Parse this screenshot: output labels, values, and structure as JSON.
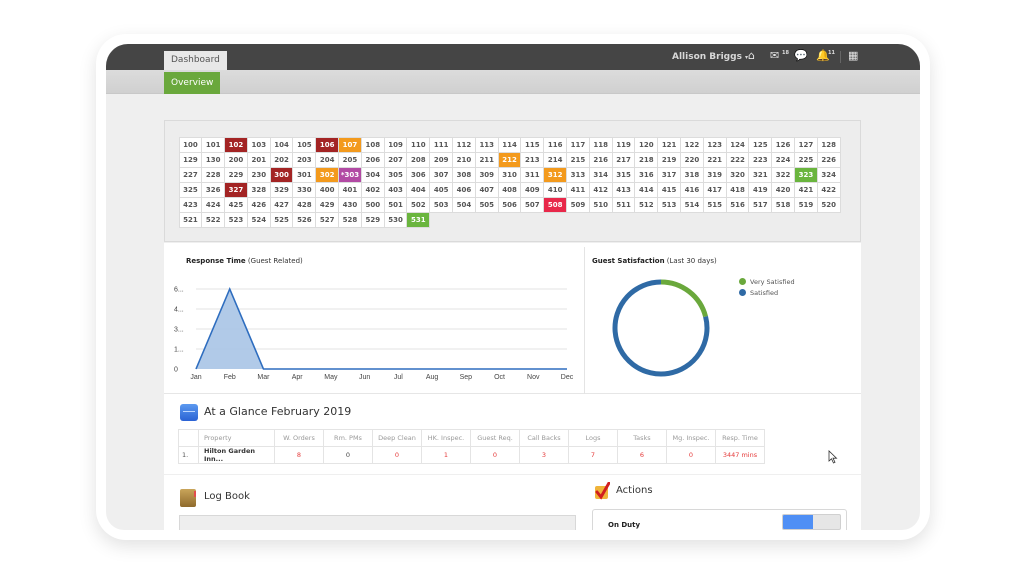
{
  "topbar": {
    "tab_label": "Dashboard",
    "user_name": "Allison Briggs",
    "user_caret": "▾",
    "icons": [
      {
        "name": "home-icon",
        "glyph": "⌂",
        "badge": ""
      },
      {
        "name": "mail-icon",
        "glyph": "✉",
        "badge": "18"
      },
      {
        "name": "chat-icon",
        "glyph": "💬",
        "badge": ""
      },
      {
        "name": "bell-icon",
        "glyph": "🔔",
        "badge": "11"
      },
      {
        "name": "grid-menu-icon",
        "glyph": "▦",
        "badge": ""
      }
    ]
  },
  "subbar": {
    "tab_label": "Overview",
    "accent": "#6aa83c"
  },
  "room_status_colors": {
    "dark": "#a32424",
    "orange": "#f39a1d",
    "purple": "#b24aa4",
    "red": "#e8284a",
    "green": "#6ab53e"
  },
  "rooms": [
    {
      "n": "100"
    },
    {
      "n": "101"
    },
    {
      "n": "102",
      "s": "dark"
    },
    {
      "n": "103"
    },
    {
      "n": "104"
    },
    {
      "n": "105"
    },
    {
      "n": "106",
      "s": "dark"
    },
    {
      "n": "107",
      "s": "orange"
    },
    {
      "n": "108"
    },
    {
      "n": "109"
    },
    {
      "n": "110"
    },
    {
      "n": "111"
    },
    {
      "n": "112"
    },
    {
      "n": "113"
    },
    {
      "n": "114"
    },
    {
      "n": "115"
    },
    {
      "n": "116"
    },
    {
      "n": "117"
    },
    {
      "n": "118"
    },
    {
      "n": "119"
    },
    {
      "n": "120"
    },
    {
      "n": "121"
    },
    {
      "n": "122"
    },
    {
      "n": "123"
    },
    {
      "n": "124"
    },
    {
      "n": "125"
    },
    {
      "n": "126"
    },
    {
      "n": "127"
    },
    {
      "n": "128"
    },
    {
      "n": "129"
    },
    {
      "n": "130"
    },
    {
      "n": "200"
    },
    {
      "n": "201"
    },
    {
      "n": "202"
    },
    {
      "n": "203"
    },
    {
      "n": "204"
    },
    {
      "n": "205"
    },
    {
      "n": "206"
    },
    {
      "n": "207"
    },
    {
      "n": "208"
    },
    {
      "n": "209"
    },
    {
      "n": "210"
    },
    {
      "n": "211"
    },
    {
      "n": "212",
      "s": "orange"
    },
    {
      "n": "213"
    },
    {
      "n": "214"
    },
    {
      "n": "215"
    },
    {
      "n": "216"
    },
    {
      "n": "217"
    },
    {
      "n": "218"
    },
    {
      "n": "219"
    },
    {
      "n": "220"
    },
    {
      "n": "221"
    },
    {
      "n": "222"
    },
    {
      "n": "223"
    },
    {
      "n": "224"
    },
    {
      "n": "225"
    },
    {
      "n": "226"
    },
    {
      "n": "227"
    },
    {
      "n": "228"
    },
    {
      "n": "229"
    },
    {
      "n": "230"
    },
    {
      "n": "300",
      "s": "dark"
    },
    {
      "n": "301"
    },
    {
      "n": "302",
      "s": "orange"
    },
    {
      "n": "*303",
      "s": "purple"
    },
    {
      "n": "304"
    },
    {
      "n": "305"
    },
    {
      "n": "306"
    },
    {
      "n": "307"
    },
    {
      "n": "308"
    },
    {
      "n": "309"
    },
    {
      "n": "310"
    },
    {
      "n": "311"
    },
    {
      "n": "312",
      "s": "orange"
    },
    {
      "n": "313"
    },
    {
      "n": "314"
    },
    {
      "n": "315"
    },
    {
      "n": "316"
    },
    {
      "n": "317"
    },
    {
      "n": "318"
    },
    {
      "n": "319"
    },
    {
      "n": "320"
    },
    {
      "n": "321"
    },
    {
      "n": "322"
    },
    {
      "n": "323",
      "s": "green"
    },
    {
      "n": "324"
    },
    {
      "n": "325"
    },
    {
      "n": "326"
    },
    {
      "n": "327",
      "s": "dark"
    },
    {
      "n": "328"
    },
    {
      "n": "329"
    },
    {
      "n": "330"
    },
    {
      "n": "400"
    },
    {
      "n": "401"
    },
    {
      "n": "402"
    },
    {
      "n": "403"
    },
    {
      "n": "404"
    },
    {
      "n": "405"
    },
    {
      "n": "406"
    },
    {
      "n": "407"
    },
    {
      "n": "408"
    },
    {
      "n": "409"
    },
    {
      "n": "410"
    },
    {
      "n": "411"
    },
    {
      "n": "412"
    },
    {
      "n": "413"
    },
    {
      "n": "414"
    },
    {
      "n": "415"
    },
    {
      "n": "416"
    },
    {
      "n": "417"
    },
    {
      "n": "418"
    },
    {
      "n": "419"
    },
    {
      "n": "420"
    },
    {
      "n": "421"
    },
    {
      "n": "422"
    },
    {
      "n": "423"
    },
    {
      "n": "424"
    },
    {
      "n": "425"
    },
    {
      "n": "426"
    },
    {
      "n": "427"
    },
    {
      "n": "428"
    },
    {
      "n": "429"
    },
    {
      "n": "430"
    },
    {
      "n": "500"
    },
    {
      "n": "501"
    },
    {
      "n": "502"
    },
    {
      "n": "503"
    },
    {
      "n": "504"
    },
    {
      "n": "505"
    },
    {
      "n": "506"
    },
    {
      "n": "507"
    },
    {
      "n": "508",
      "s": "red"
    },
    {
      "n": "509"
    },
    {
      "n": "510"
    },
    {
      "n": "511"
    },
    {
      "n": "512"
    },
    {
      "n": "513"
    },
    {
      "n": "514"
    },
    {
      "n": "515"
    },
    {
      "n": "516"
    },
    {
      "n": "517"
    },
    {
      "n": "518"
    },
    {
      "n": "519"
    },
    {
      "n": "520"
    },
    {
      "n": "521"
    },
    {
      "n": "522"
    },
    {
      "n": "523"
    },
    {
      "n": "524"
    },
    {
      "n": "525"
    },
    {
      "n": "526"
    },
    {
      "n": "527"
    },
    {
      "n": "528"
    },
    {
      "n": "529"
    },
    {
      "n": "530"
    },
    {
      "n": "531",
      "s": "green"
    }
  ],
  "response_chart": {
    "title_bold": "Response Time",
    "title_rest": " (Guest Related)"
  },
  "satisfaction_chart": {
    "title_bold": "Guest Satisfaction",
    "title_rest": " (Last 30 days)"
  },
  "chart_data": [
    {
      "type": "area",
      "title": "Response Time (Guest Related)",
      "xlabel": "",
      "ylabel": "",
      "categories": [
        "Jan",
        "Feb",
        "Mar",
        "Apr",
        "May",
        "Jun",
        "Jul",
        "Aug",
        "Sep",
        "Oct",
        "Nov",
        "Dec"
      ],
      "values": [
        0,
        5.9,
        0,
        0,
        0,
        0,
        0,
        0,
        0,
        0,
        0,
        0
      ],
      "ytick_labels": [
        "0",
        "1...",
        "3...",
        "4...",
        "6..."
      ],
      "ytick_values": [
        0,
        1.475,
        2.95,
        4.425,
        5.9
      ],
      "ylim": [
        0,
        5.9
      ],
      "grid": true,
      "color": "#2e6dbf",
      "fill": "#a9c4e6"
    },
    {
      "type": "pie",
      "donut": true,
      "title": "Guest Satisfaction (Last 30 days)",
      "legend_position": "right",
      "series": [
        {
          "name": "Very Satisfied",
          "value": 21,
          "color": "#6aa83c"
        },
        {
          "name": "Satisfied",
          "value": 79,
          "color": "#2f6aa5"
        }
      ]
    }
  ],
  "glance": {
    "title": "At a Glance February 2019",
    "headers": [
      "",
      "Property",
      "W. Orders",
      "Rm. PMs",
      "Deep Clean",
      "HK. Inspec.",
      "Guest Req.",
      "Call Backs",
      "Logs",
      "Tasks",
      "Mg. Inspec.",
      "Resp. Time"
    ],
    "rows": [
      {
        "cells": [
          "1.",
          "Hilton Garden Inn...",
          "8",
          "0",
          "0",
          "1",
          "0",
          "3",
          "7",
          "6",
          "0",
          "3447 mins"
        ],
        "red": [
          false,
          false,
          true,
          false,
          true,
          true,
          true,
          true,
          true,
          true,
          true,
          true
        ]
      }
    ]
  },
  "logbook": {
    "title": "Log Book"
  },
  "actions": {
    "title": "Actions",
    "on_duty_label": "On Duty",
    "on_duty": true
  }
}
